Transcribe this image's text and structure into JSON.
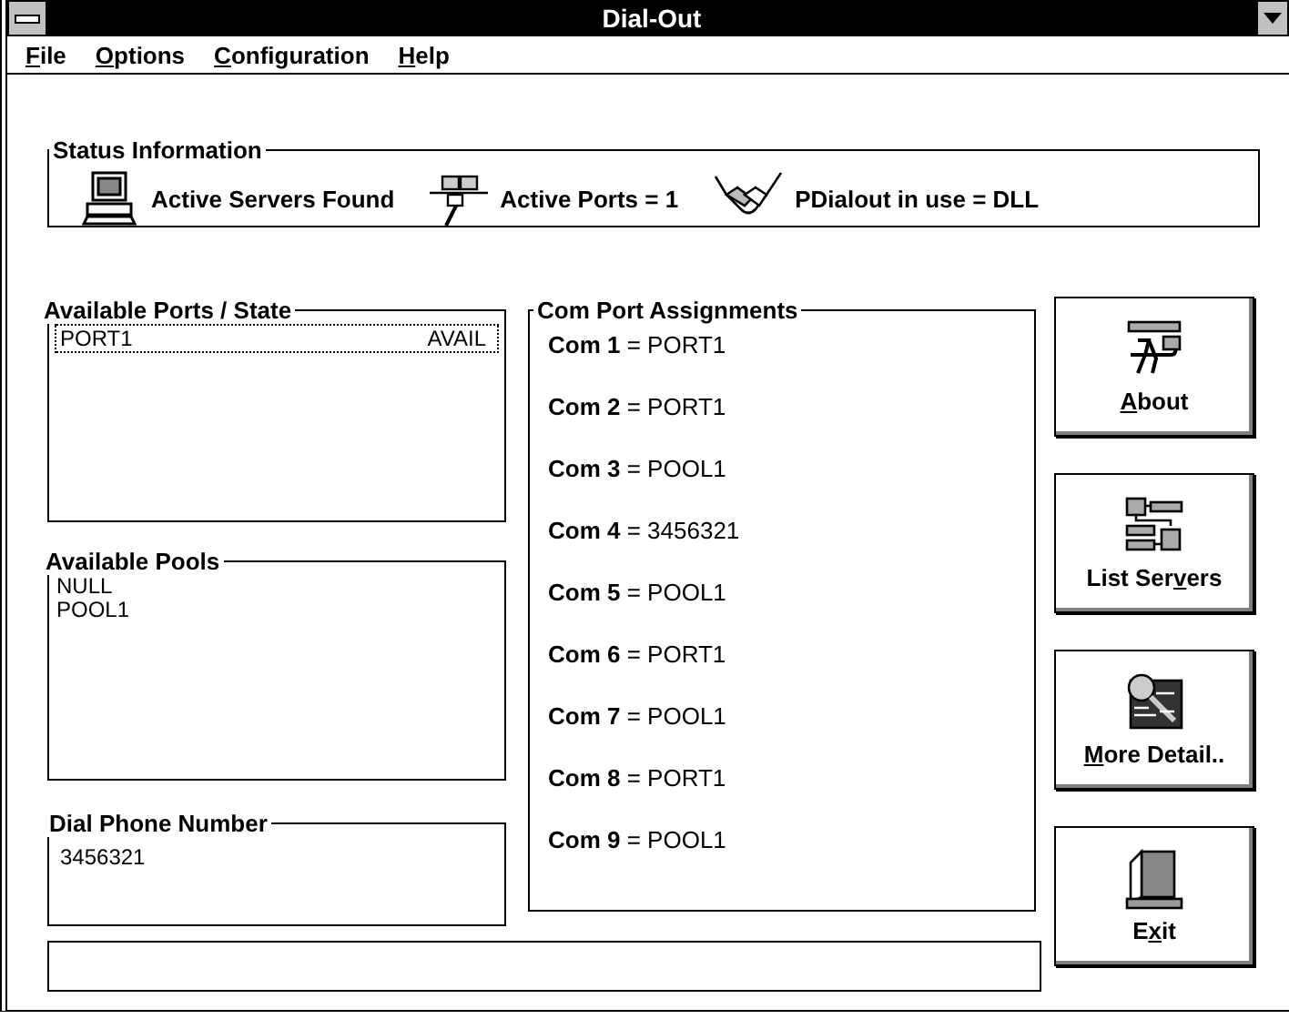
{
  "window": {
    "title": "Dial-Out"
  },
  "menu": [
    {
      "key": "F",
      "after": "ile"
    },
    {
      "key": "O",
      "after": "ptions"
    },
    {
      "key": "C",
      "after": "onfiguration"
    },
    {
      "key": "H",
      "after": "elp"
    }
  ],
  "status": {
    "title": "Status Information",
    "servers": "Active Servers Found",
    "ports": "Active Ports = 1",
    "dialout": "PDialout in use = DLL"
  },
  "ports": {
    "title": "Available Ports / State",
    "rows": [
      {
        "port": "PORT1",
        "state": "AVAIL",
        "selected": true
      }
    ]
  },
  "pools": {
    "title": "Available Pools",
    "items": [
      "NULL",
      "POOL1"
    ]
  },
  "dial": {
    "title": "Dial Phone Number",
    "value": "3456321"
  },
  "com": {
    "title": "Com Port Assignments",
    "items": [
      "**Com 1** = PORT1",
      "**Com 2** = PORT1",
      "**Com 3** = POOL1",
      "**Com 4** = 3456321",
      "**Com 5** = POOL1",
      "**Com 6** = PORT1",
      "**Com 7** = POOL1",
      "**Com 8** = PORT1",
      "**Com 9** = POOL1"
    ]
  },
  "buttons": [
    {
      "kind": "about",
      "key": "A",
      "after": "bout"
    },
    {
      "kind": "servers",
      "before": "List Ser",
      "key": "v",
      "after": "ers"
    },
    {
      "kind": "detail",
      "key": "M",
      "after": "ore Detail.."
    },
    {
      "kind": "exit",
      "before": "E",
      "key": "x",
      "after": "it"
    }
  ]
}
